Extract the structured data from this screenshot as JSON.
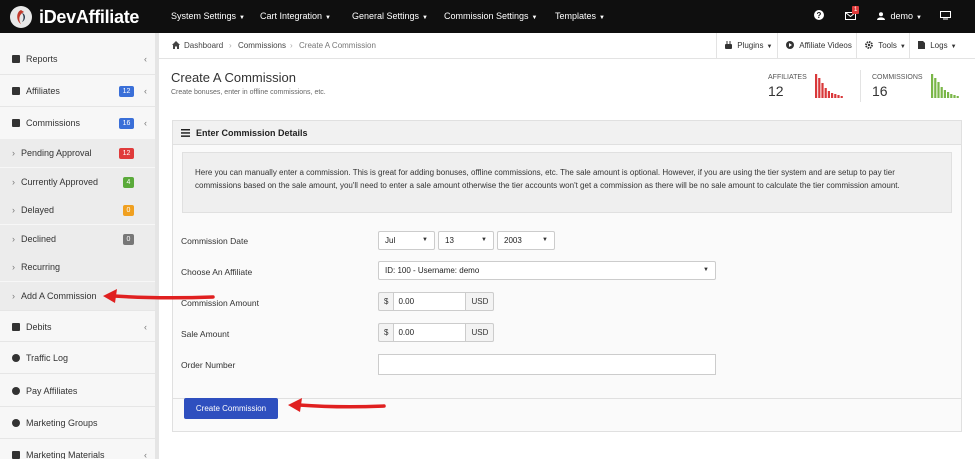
{
  "app": {
    "name": "iDevAffiliate"
  },
  "topnav": {
    "items": [
      "System Settings",
      "Cart Integration",
      "General Settings",
      "Commission Settings",
      "Templates"
    ],
    "help_icon": "question-circle-icon",
    "mail_badge": "1",
    "user": "demo",
    "monitor_icon": "monitor-icon"
  },
  "sidebar": {
    "reports": "Reports",
    "affiliates": "Affiliates",
    "affiliates_badge": "12",
    "commissions": "Commissions",
    "commissions_badge": "16",
    "pending": "Pending Approval",
    "pending_badge": "12",
    "approved": "Currently Approved",
    "approved_badge": "4",
    "delayed": "Delayed",
    "delayed_badge": "0",
    "declined": "Declined",
    "declined_badge": "0",
    "recurring": "Recurring",
    "add_commission": "Add A Commission",
    "debits": "Debits",
    "traffic_log": "Traffic Log",
    "pay_affiliates": "Pay Affiliates",
    "marketing_groups": "Marketing Groups",
    "marketing_materials": "Marketing Materials"
  },
  "colors": {
    "badge_blue": "#3a6fd8",
    "badge_red": "#e03b3b",
    "badge_green": "#5aaa3a",
    "badge_orange": "#f0a020",
    "badge_gray": "#777777",
    "spark_red": "#d9383a",
    "spark_green": "#7ab648",
    "button": "#2e4fbf"
  },
  "breadcrumb": {
    "dashboard": "Dashboard",
    "commissions": "Commissions",
    "current": "Create A Commission"
  },
  "toolbar": {
    "plugins": "Plugins",
    "affiliate_videos": "Affiliate Videos",
    "tools": "Tools",
    "logs": "Logs"
  },
  "header": {
    "title": "Create A Commission",
    "subtitle": "Create bonuses, enter in offline commissions, etc.",
    "affiliates_label": "AFFILIATES",
    "affiliates_count": "12",
    "commissions_label": "COMMISSIONS",
    "commissions_count": "16"
  },
  "panel": {
    "title": "Enter Commission Details",
    "info": "Here you can manually enter a commission. This is great for adding bonuses, offline commissions, etc. The sale amount is optional. However, if you are using the tier system and are setup to pay tier commissions based on the sale amount, you'll need to enter a sale amount otherwise the tier accounts won't get a commission as there will be no sale amount to calculate the tier commission amount."
  },
  "form": {
    "date_label": "Commission Date",
    "month": "Jul",
    "day": "13",
    "year": "2003",
    "affiliate_label": "Choose An Affiliate",
    "affiliate_value": "ID: 100 - Username: demo",
    "commission_amount_label": "Commission Amount",
    "commission_amount": "0.00",
    "sale_amount_label": "Sale Amount",
    "sale_amount": "0.00",
    "currency_symbol": "$",
    "currency": "USD",
    "order_number_label": "Order Number",
    "order_number": "",
    "submit": "Create Commission"
  }
}
